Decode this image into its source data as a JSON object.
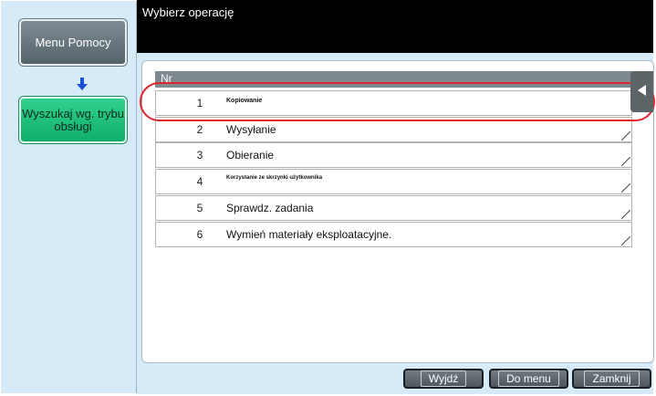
{
  "header": {
    "title": "Wybierz operację"
  },
  "sidebar": {
    "help_menu": "Menu Pomocy",
    "search_mode": "Wyszukaj wg. trybu obsługi"
  },
  "table": {
    "header": "Nr",
    "rows": [
      {
        "num": "1",
        "label": "Kopiowanie"
      },
      {
        "num": "2",
        "label": "Wysyłanie"
      },
      {
        "num": "3",
        "label": "Obieranie"
      },
      {
        "num": "4",
        "label": "Korzystanie ze skrzynki użytkownika"
      },
      {
        "num": "5",
        "label": "Sprawdz. zadania"
      },
      {
        "num": "6",
        "label": "Wymień materiały eksploatacyjne."
      }
    ]
  },
  "footer": {
    "exit": "Wyjdź",
    "to_menu": "Do menu",
    "close": "Zamknij"
  },
  "colors": {
    "panel": "#d6eaf8",
    "header": "#000000",
    "highlight": "#e0262c",
    "search_button": "#1bbf79"
  }
}
